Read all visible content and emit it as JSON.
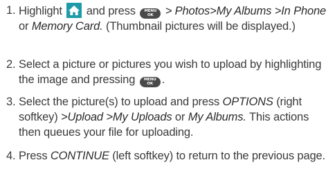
{
  "steps": [
    {
      "number": "1.",
      "t1": "Highlight",
      "t2": "and press",
      "t3": "> Photos",
      "t4": ">",
      "t5": "My Albums",
      "t6": ">",
      "t7": "In Phone",
      "t8": "or",
      "t9": "Memory Card.",
      "t10": "(Thumbnail pictures will be displayed.)"
    },
    {
      "number": "2.",
      "t1": "Select a picture or pictures you wish to upload by highlighting the image and pressing",
      "t2": "."
    },
    {
      "number": "3.",
      "t1": "Select the picture(s) to upload and press",
      "t2": "OPTIONS",
      "t3": "(right softkey)",
      "t4": ">",
      "t5": "Upload",
      "t6": ">",
      "t7": "My Uploads",
      "t8": "or",
      "t9": "My Albums.",
      "t10": "This actions then queues your file for uploading."
    },
    {
      "number": "4.",
      "t1": "Press",
      "t2": "CONTINUE",
      "t3": "(left softkey) to return to the previous page."
    }
  ],
  "icons": {
    "home_icon": "home-icon",
    "menu_key_icon": "menu-ok-key-icon",
    "home_color": "#1f9aa9",
    "menu_color": "#4a4a4a"
  },
  "menu_key": {
    "line1": "MENU",
    "line2": "OK"
  }
}
